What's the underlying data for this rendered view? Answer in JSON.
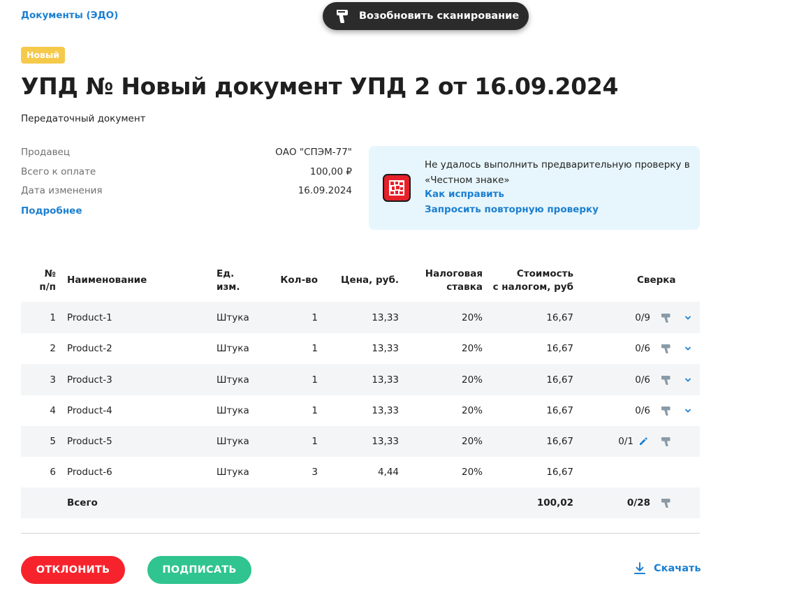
{
  "breadcrumb": "Документы (ЭДО)",
  "scan_button": {
    "label": "Возобновить сканирование",
    "icon": "scanner-icon"
  },
  "status_badge": "Новый",
  "title": "УПД № Новый документ УПД 2 от 16.09.2024",
  "subtitle": "Передаточный документ",
  "info": [
    {
      "key": "Продавец",
      "value": "ОАО \"СПЭМ-77\""
    },
    {
      "key": "Всего к оплате",
      "value": "100,00 ₽"
    },
    {
      "key": "Дата изменения",
      "value": "16.09.2024"
    }
  ],
  "more_link": "Подробнее",
  "notice": {
    "icon": "chestny-znak-icon",
    "message": "Не удалось выполнить предварительную проверку в «Честном знаке»",
    "fix_link": "Как исправить",
    "recheck_link": "Запросить повторную проверку"
  },
  "table": {
    "headers": {
      "num_1": "№",
      "num_2": "п/п",
      "name": "Наименование",
      "unit_1": "Ед.",
      "unit_2": "изм.",
      "qty": "Кол-во",
      "price": "Цена, руб.",
      "tax_1": "Налоговая",
      "tax_2": "ставка",
      "cost_1": "Стоимость",
      "cost_2": "с налогом, руб",
      "check": "Сверка"
    },
    "rows": [
      {
        "num": "1",
        "name": "Product-1",
        "unit": "Штука",
        "qty": "1",
        "price": "13,33",
        "tax": "20%",
        "cost": "16,67",
        "check": "0/9"
      },
      {
        "num": "2",
        "name": "Product-2",
        "unit": "Штука",
        "qty": "1",
        "price": "13,33",
        "tax": "20%",
        "cost": "16,67",
        "check": "0/6"
      },
      {
        "num": "3",
        "name": "Product-3",
        "unit": "Штука",
        "qty": "1",
        "price": "13,33",
        "tax": "20%",
        "cost": "16,67",
        "check": "0/6"
      },
      {
        "num": "4",
        "name": "Product-4",
        "unit": "Штука",
        "qty": "1",
        "price": "13,33",
        "tax": "20%",
        "cost": "16,67",
        "check": "0/6"
      },
      {
        "num": "5",
        "name": "Product-5",
        "unit": "Штука",
        "qty": "1",
        "price": "13,33",
        "tax": "20%",
        "cost": "16,67",
        "check": "0/1"
      },
      {
        "num": "6",
        "name": "Product-6",
        "unit": "Штука",
        "qty": "3",
        "price": "4,44",
        "tax": "20%",
        "cost": "16,67",
        "check": ""
      }
    ],
    "total": {
      "label": "Всего",
      "cost": "100,02",
      "check": "0/28"
    }
  },
  "actions": {
    "reject": "ОТКЛОНИТЬ",
    "sign": "ПОДПИСАТЬ",
    "download": "Скачать"
  },
  "colors": {
    "link": "#1b7fd1",
    "reject": "#f7232c",
    "sign": "#2fc490",
    "badge": "#f5c94a",
    "notice_bg": "#e7f6fc"
  }
}
